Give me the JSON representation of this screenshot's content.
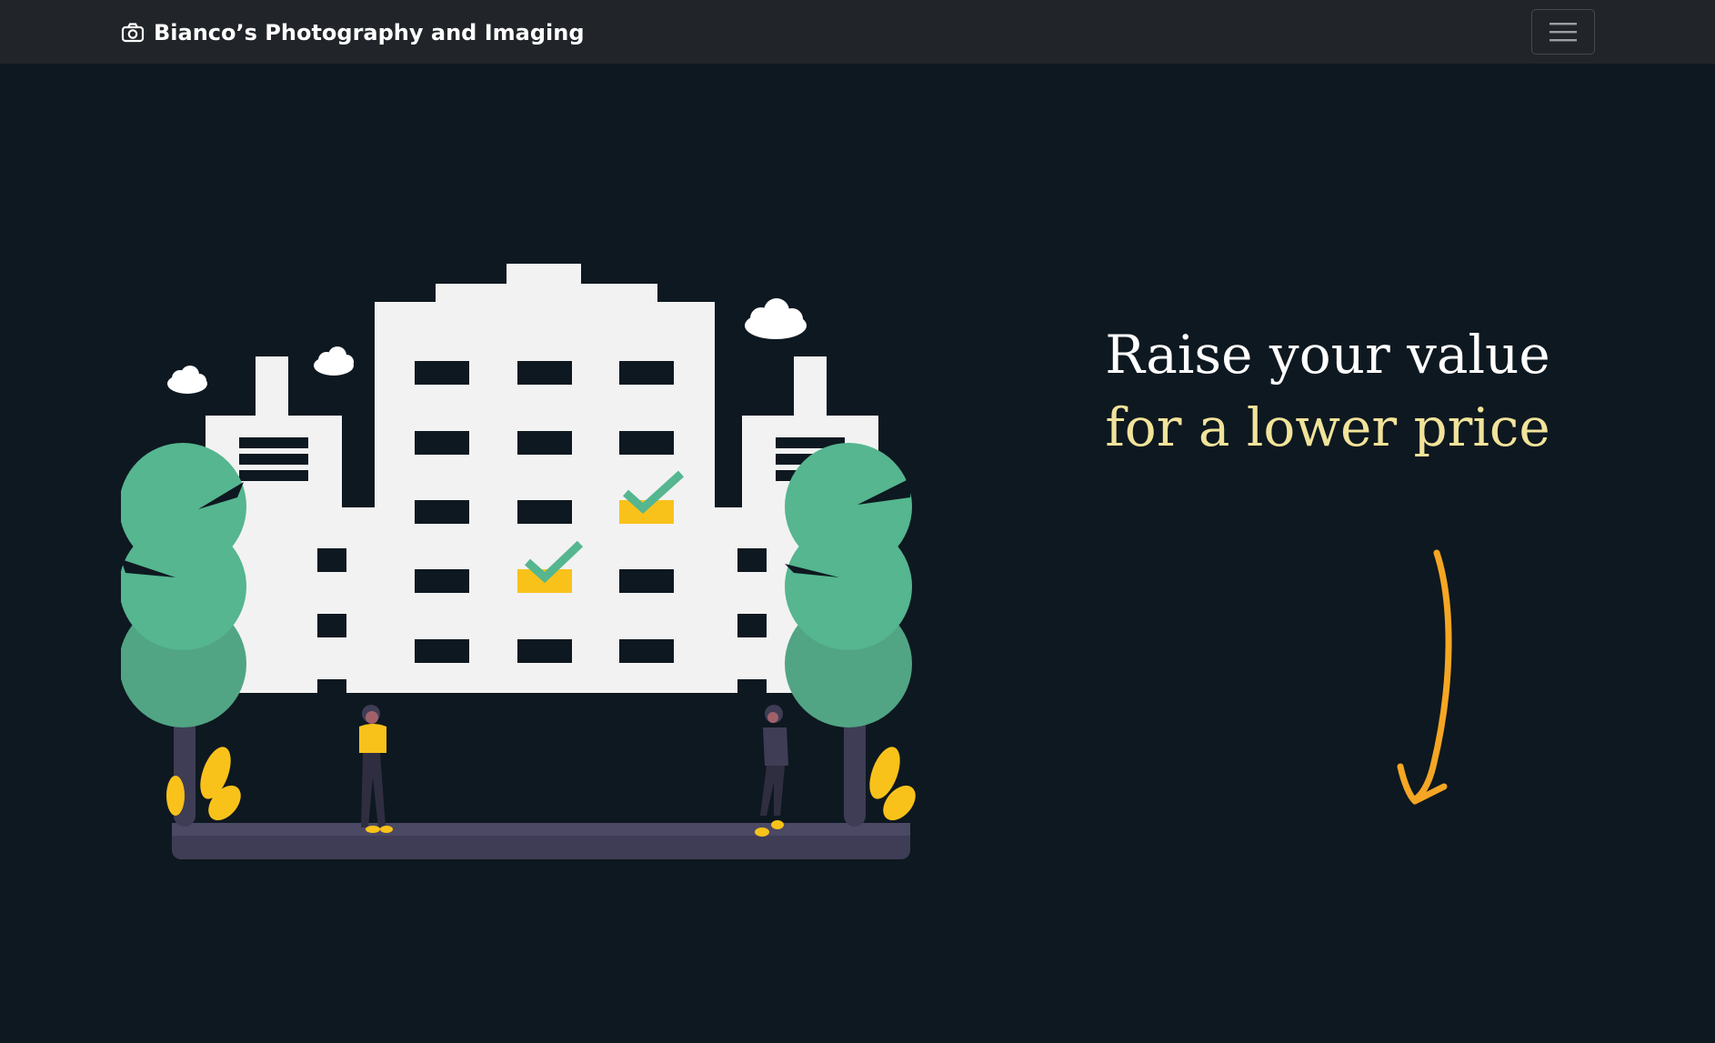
{
  "navbar": {
    "brand": "Bianco’s Photography and Imaging",
    "brand_icon": "camera-icon",
    "toggler_icon": "hamburger-menu-icon"
  },
  "hero": {
    "headline_line1": "Raise your value",
    "headline_line2": "for a lower price",
    "illustration": "building-with-trees-and-people",
    "arrow_icon": "curved-down-arrow-icon"
  },
  "colors": {
    "background": "#0e1820",
    "navbar": "#212529",
    "headline_primary": "#ffffff",
    "headline_accent": "#f1e39a",
    "arrow": "#f5a623",
    "tree_green": "#55b690",
    "accent_yellow": "#f9c21a",
    "building": "#f2f2f2"
  }
}
